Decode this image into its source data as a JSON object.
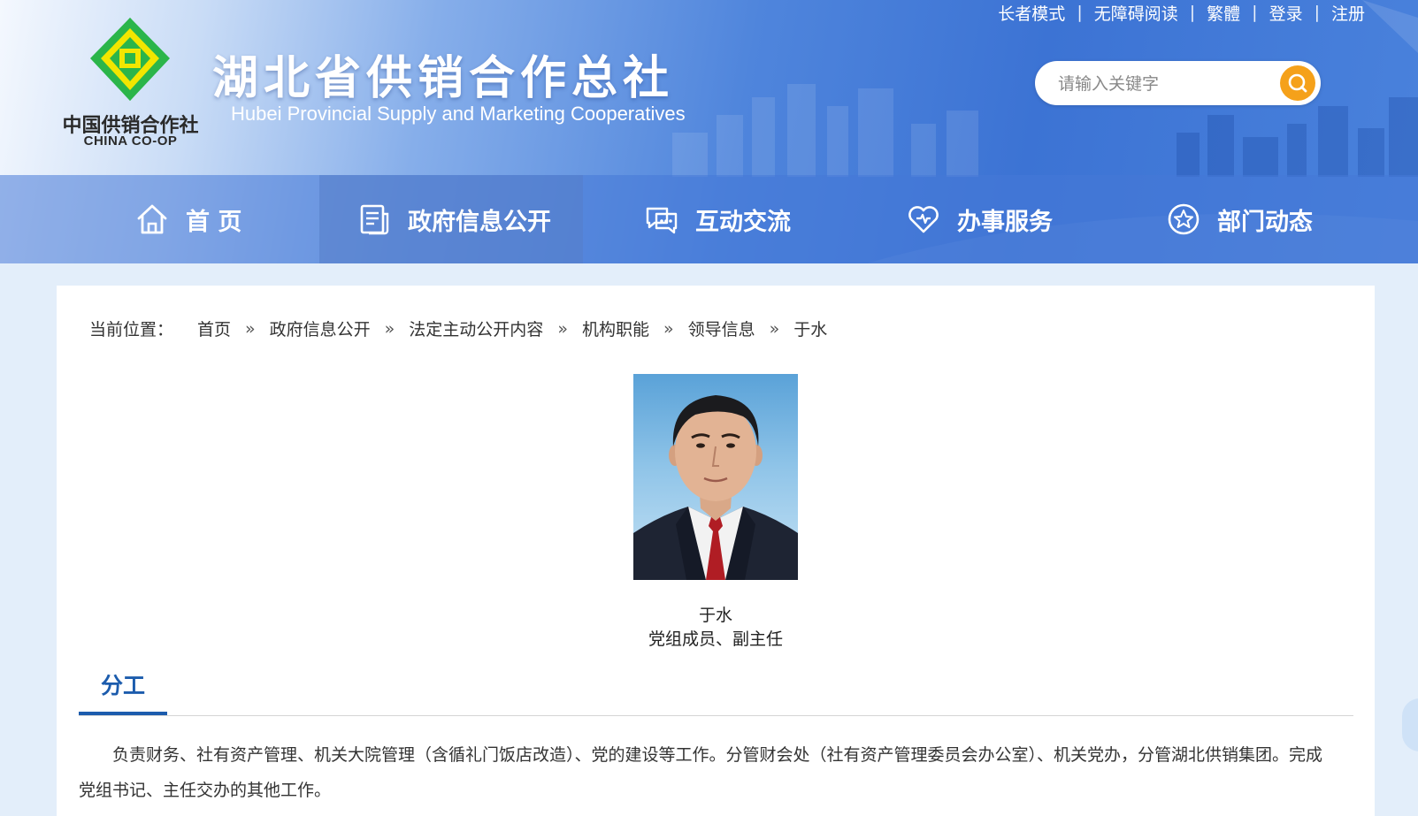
{
  "topbar": {
    "links": [
      "长者模式",
      "无障碍阅读",
      "繁體",
      "登录",
      "注册"
    ]
  },
  "logo": {
    "cn": "中国供销合作社",
    "en": "CHINA CO-OP"
  },
  "site": {
    "title": "湖北省供销合作总社",
    "subtitle": "Hubei Provincial Supply and Marketing Cooperatives"
  },
  "search": {
    "placeholder": "请输入关键字"
  },
  "nav": {
    "items": [
      {
        "label": "首 页",
        "icon": "home-icon"
      },
      {
        "label": "政府信息公开",
        "icon": "document-icon"
      },
      {
        "label": "互动交流",
        "icon": "chat-icon"
      },
      {
        "label": "办事服务",
        "icon": "heart-icon"
      },
      {
        "label": "部门动态",
        "icon": "star-icon"
      }
    ],
    "active_index": 1
  },
  "breadcrumb": {
    "label": "当前位置：",
    "items": [
      "首页",
      "政府信息公开",
      "法定主动公开内容",
      "机构职能",
      "领导信息",
      "于水"
    ],
    "separator": "»"
  },
  "profile": {
    "name": "于水",
    "title": "党组成员、副主任"
  },
  "section": {
    "tab_label": "分工",
    "text": "负责财务、社有资产管理、机关大院管理（含循礼门饭店改造）、党的建设等工作。分管财会处（社有资产管理委员会办公室）、机关党办，分管湖北供销集团。完成党组书记、主任交办的其他工作。"
  },
  "colors": {
    "accent": "#1c5cad",
    "search_button": "#f5a11a",
    "logo_green": "#2bb54a",
    "logo_yellow": "#f2e600"
  }
}
